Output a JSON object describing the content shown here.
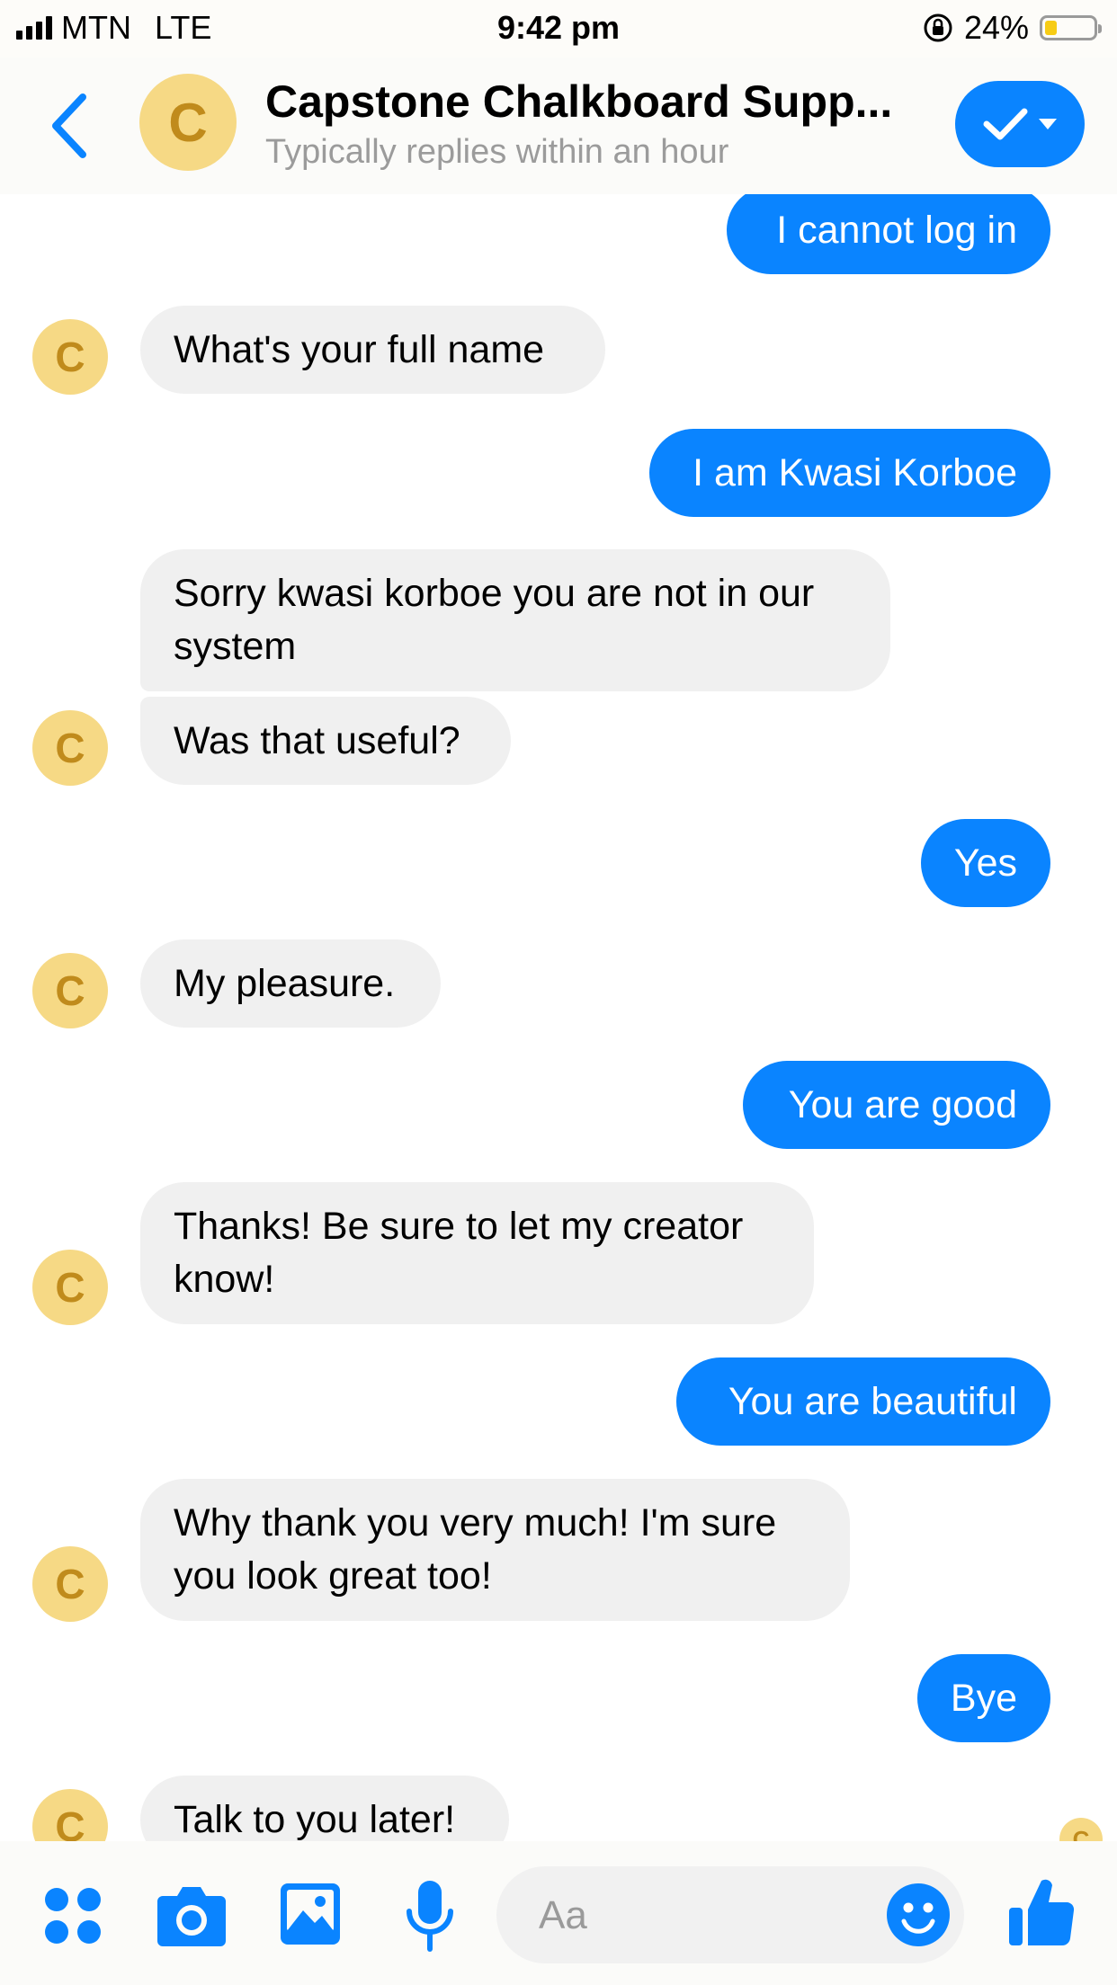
{
  "status_bar": {
    "carrier": "MTN",
    "network": "LTE",
    "time": "9:42 pm",
    "battery": "24%"
  },
  "header": {
    "avatar_letter": "C",
    "title": "Capstone Chalkboard Supp...",
    "subtitle": "Typically replies within an hour"
  },
  "messages": [
    {
      "from": "me",
      "text": "I cannot log in"
    },
    {
      "from": "bot",
      "text": "What's your full name"
    },
    {
      "from": "me",
      "text": "I am Kwasi Korboe"
    },
    {
      "from": "bot",
      "text": "Sorry kwasi korboe you are not in our system"
    },
    {
      "from": "bot",
      "text": "Was that useful?"
    },
    {
      "from": "me",
      "text": "Yes"
    },
    {
      "from": "bot",
      "text": "My pleasure."
    },
    {
      "from": "me",
      "text": "You are good"
    },
    {
      "from": "bot",
      "text": "Thanks! Be sure to let my creator know!"
    },
    {
      "from": "me",
      "text": "You are beautiful"
    },
    {
      "from": "bot",
      "text": "Why thank you very much! I'm sure you look great too!"
    },
    {
      "from": "me",
      "text": "Bye"
    },
    {
      "from": "bot",
      "text": "Talk to you later!"
    }
  ],
  "avatar_letter": "C",
  "composer": {
    "placeholder": "Aa"
  },
  "colors": {
    "accent": "#0a84ff",
    "incoming_bubble": "#f0f0f0",
    "avatar_bg": "#f6d985",
    "avatar_fg": "#c08b1c"
  },
  "icons": [
    "more-icon",
    "camera-icon",
    "gallery-icon",
    "microphone-icon",
    "emoji-icon",
    "thumbs-up-icon",
    "checkmark-icon",
    "back-chevron-icon"
  ]
}
